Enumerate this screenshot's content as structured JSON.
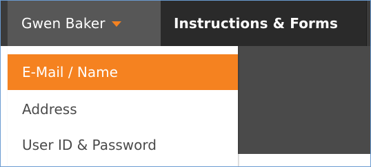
{
  "nav": {
    "user_label": "Gwen Baker",
    "instructions_label": "Instructions & Forms",
    "accent_color": "#f58220"
  },
  "dropdown": {
    "items": [
      {
        "label": "E-Mail / Name",
        "active": true
      },
      {
        "label": "Address",
        "active": false
      },
      {
        "label": "User ID & Password",
        "active": false
      }
    ]
  }
}
